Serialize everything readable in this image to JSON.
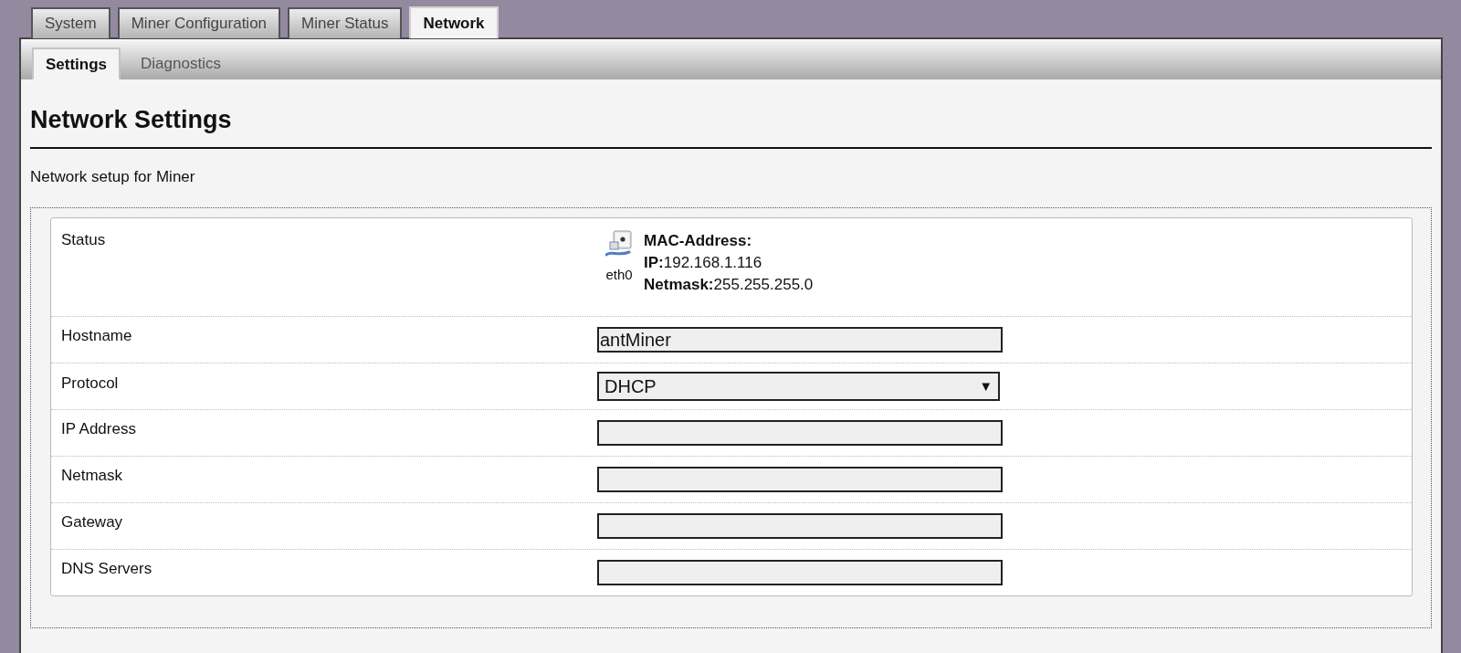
{
  "main_tabs": [
    {
      "label": "System",
      "selected": false
    },
    {
      "label": "Miner Configuration",
      "selected": false
    },
    {
      "label": "Miner Status",
      "selected": false
    },
    {
      "label": "Network",
      "selected": true
    }
  ],
  "sub_tabs": [
    {
      "label": "Settings",
      "selected": true
    },
    {
      "label": "Diagnostics",
      "selected": false
    }
  ],
  "page": {
    "title": "Network Settings",
    "description": "Network setup for Miner"
  },
  "form": {
    "rows": [
      {
        "kind": "status",
        "label": "Status",
        "interface": "eth0",
        "details": [
          {
            "label": "MAC-Address:"
          },
          {
            "label": "IP:",
            "value": "192.168.1.116"
          },
          {
            "label": "Netmask:",
            "value": "255.255.255.0"
          }
        ]
      },
      {
        "kind": "text",
        "label": "Hostname",
        "value": "antMiner"
      },
      {
        "kind": "select",
        "label": "Protocol",
        "value": "DHCP",
        "arrow": "▼"
      },
      {
        "kind": "text",
        "label": "IP Address"
      },
      {
        "kind": "text",
        "label": "Netmask"
      },
      {
        "kind": "text",
        "label": "Gateway"
      },
      {
        "kind": "text",
        "label": "DNS Servers"
      }
    ]
  }
}
